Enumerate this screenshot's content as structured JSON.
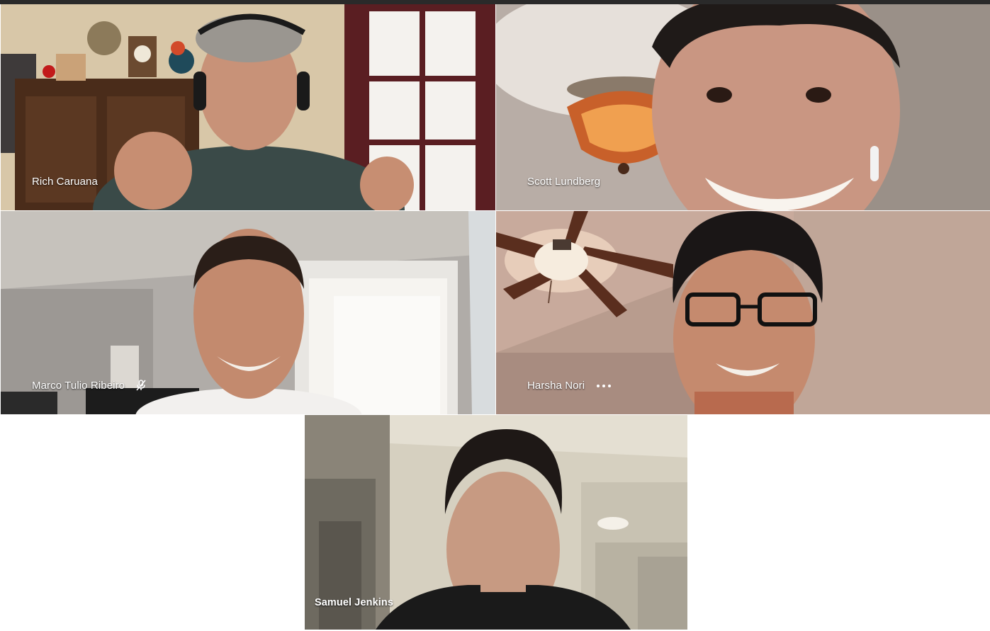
{
  "participants": [
    {
      "name": "Rich Caruana",
      "muted": false,
      "show_more": false
    },
    {
      "name": "Scott Lundberg",
      "muted": false,
      "show_more": false
    },
    {
      "name": "Marco Tulio Ribeiro",
      "muted": true,
      "show_more": false
    },
    {
      "name": "Harsha Nori",
      "muted": false,
      "show_more": true
    },
    {
      "name": "Samuel Jenkins",
      "muted": false,
      "show_more": false
    }
  ],
  "icons": {
    "muted": "mic-off-icon",
    "more": "more-options-icon"
  },
  "colors": {
    "label_text": "#ffffff",
    "page_background": "#ffffff",
    "top_border": "#2a2a2a"
  }
}
